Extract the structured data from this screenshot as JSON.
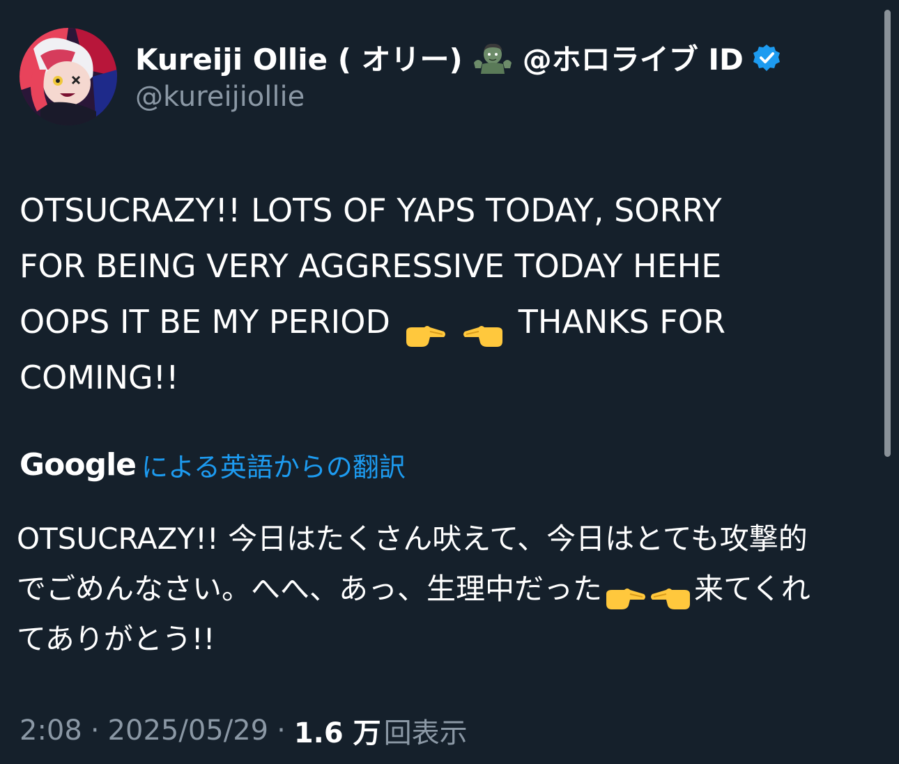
{
  "author": {
    "name_prefix": "Kureiji Ollie ( オリー)",
    "name_suffix": "@ホロライブ ID",
    "handle": "@kureijiollie",
    "name_emoji": "zombie-woman-emoji",
    "verified_icon": "verified-badge-icon",
    "verified_color": "#1d9bf0"
  },
  "tweet": {
    "lines": [
      "OTSUCRAZY!! LOTS OF YAPS TODAY, SORRY",
      "FOR BEING VERY AGGRESSIVE TODAY HEHE",
      "OOPS IT BE MY PERIOD",
      "COMING!!"
    ],
    "line3_after_emoji": "THANKS FOR",
    "emojis": [
      "backhand-index-pointing-right-emoji",
      "backhand-index-pointing-left-emoji"
    ]
  },
  "translation": {
    "provider": "Google",
    "label": "による英語からの翻訳",
    "lines": [
      "OTSUCRAZY!! 今日はたくさん吠えて、今日はとても攻撃的",
      "でごめんなさい。へへ、あっ、生理中だった",
      "てありがとう!!"
    ],
    "line2_after_emoji": "来てくれ"
  },
  "meta": {
    "time": "2:08",
    "separator": "·",
    "date": "2025/05/29",
    "views_count": "1.6 万",
    "views_label": "回表示"
  },
  "colors": {
    "background": "#15202b",
    "link": "#1d9bf0",
    "secondary_text": "#8b98a5"
  }
}
